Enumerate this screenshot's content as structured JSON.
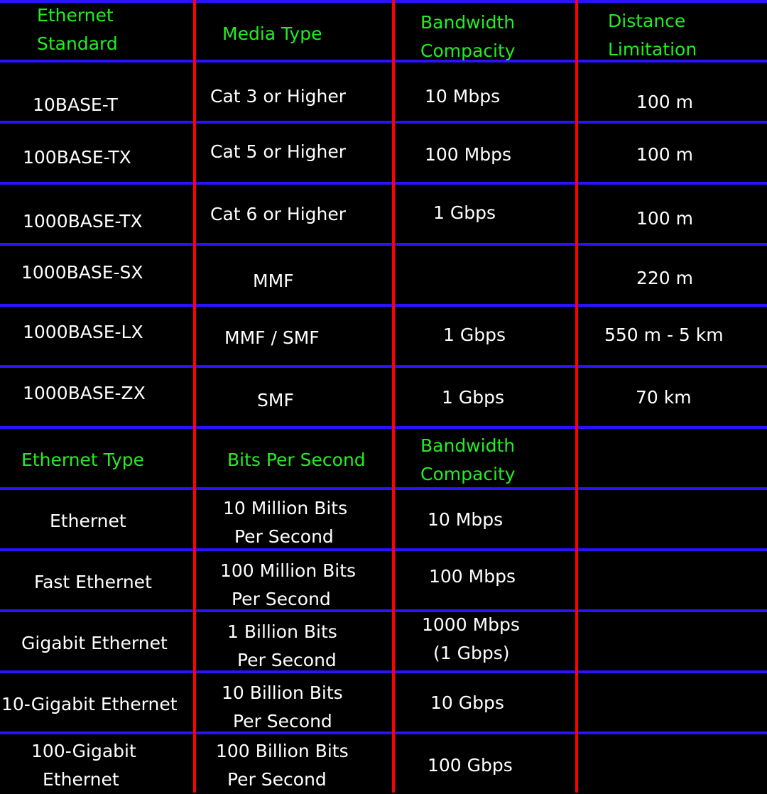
{
  "colors": {
    "background": "#000000",
    "row_divider": "#2a14ff",
    "column_divider": "#ff0000",
    "header_text": "#22ee22",
    "body_text": "#ffffff"
  },
  "standards_table": {
    "headers": [
      [
        "Ethernet",
        "Standard"
      ],
      [
        "Media Type"
      ],
      [
        "Bandwidth",
        "Compacity"
      ],
      [
        "Distance",
        "Limitation"
      ]
    ],
    "rows": [
      {
        "standard": "10BASE-T",
        "media": "Cat 3 or Higher",
        "bandwidth": "10 Mbps",
        "distance": "100 m"
      },
      {
        "standard": "100BASE-TX",
        "media": "Cat 5 or Higher",
        "bandwidth": "100 Mbps",
        "distance": "100 m"
      },
      {
        "standard": "1000BASE-TX",
        "media": "Cat 6 or Higher",
        "bandwidth": "1 Gbps",
        "distance": "100 m"
      },
      {
        "standard": "1000BASE-SX",
        "media": "MMF",
        "bandwidth": "",
        "distance": "220 m"
      },
      {
        "standard": "1000BASE-LX",
        "media": "MMF / SMF",
        "bandwidth": "1 Gbps",
        "distance": "550 m - 5 km"
      },
      {
        "standard": "1000BASE-ZX",
        "media": "SMF",
        "bandwidth": "1 Gbps",
        "distance": "70 km"
      }
    ]
  },
  "types_table": {
    "headers": [
      [
        "Ethernet Type"
      ],
      [
        "Bits Per Second"
      ],
      [
        "Bandwidth",
        "Compacity"
      ]
    ],
    "rows": [
      {
        "type": [
          "Ethernet"
        ],
        "bps": [
          "10 Million Bits",
          "Per Second"
        ],
        "bandwidth": [
          "10 Mbps"
        ]
      },
      {
        "type": [
          "Fast Ethernet"
        ],
        "bps": [
          "100 Million Bits",
          "Per Second"
        ],
        "bandwidth": [
          "100 Mbps"
        ]
      },
      {
        "type": [
          "Gigabit Ethernet"
        ],
        "bps": [
          "1 Billion Bits",
          "Per Second"
        ],
        "bandwidth": [
          "1000 Mbps",
          "(1 Gbps)"
        ]
      },
      {
        "type": [
          "10-Gigabit Ethernet"
        ],
        "bps": [
          "10 Billion Bits",
          "Per Second"
        ],
        "bandwidth": [
          "10 Gbps"
        ]
      },
      {
        "type": [
          "100-Gigabit",
          "Ethernet"
        ],
        "bps": [
          "100 Billion Bits",
          "Per Second"
        ],
        "bandwidth": [
          "100 Gbps"
        ]
      }
    ]
  }
}
